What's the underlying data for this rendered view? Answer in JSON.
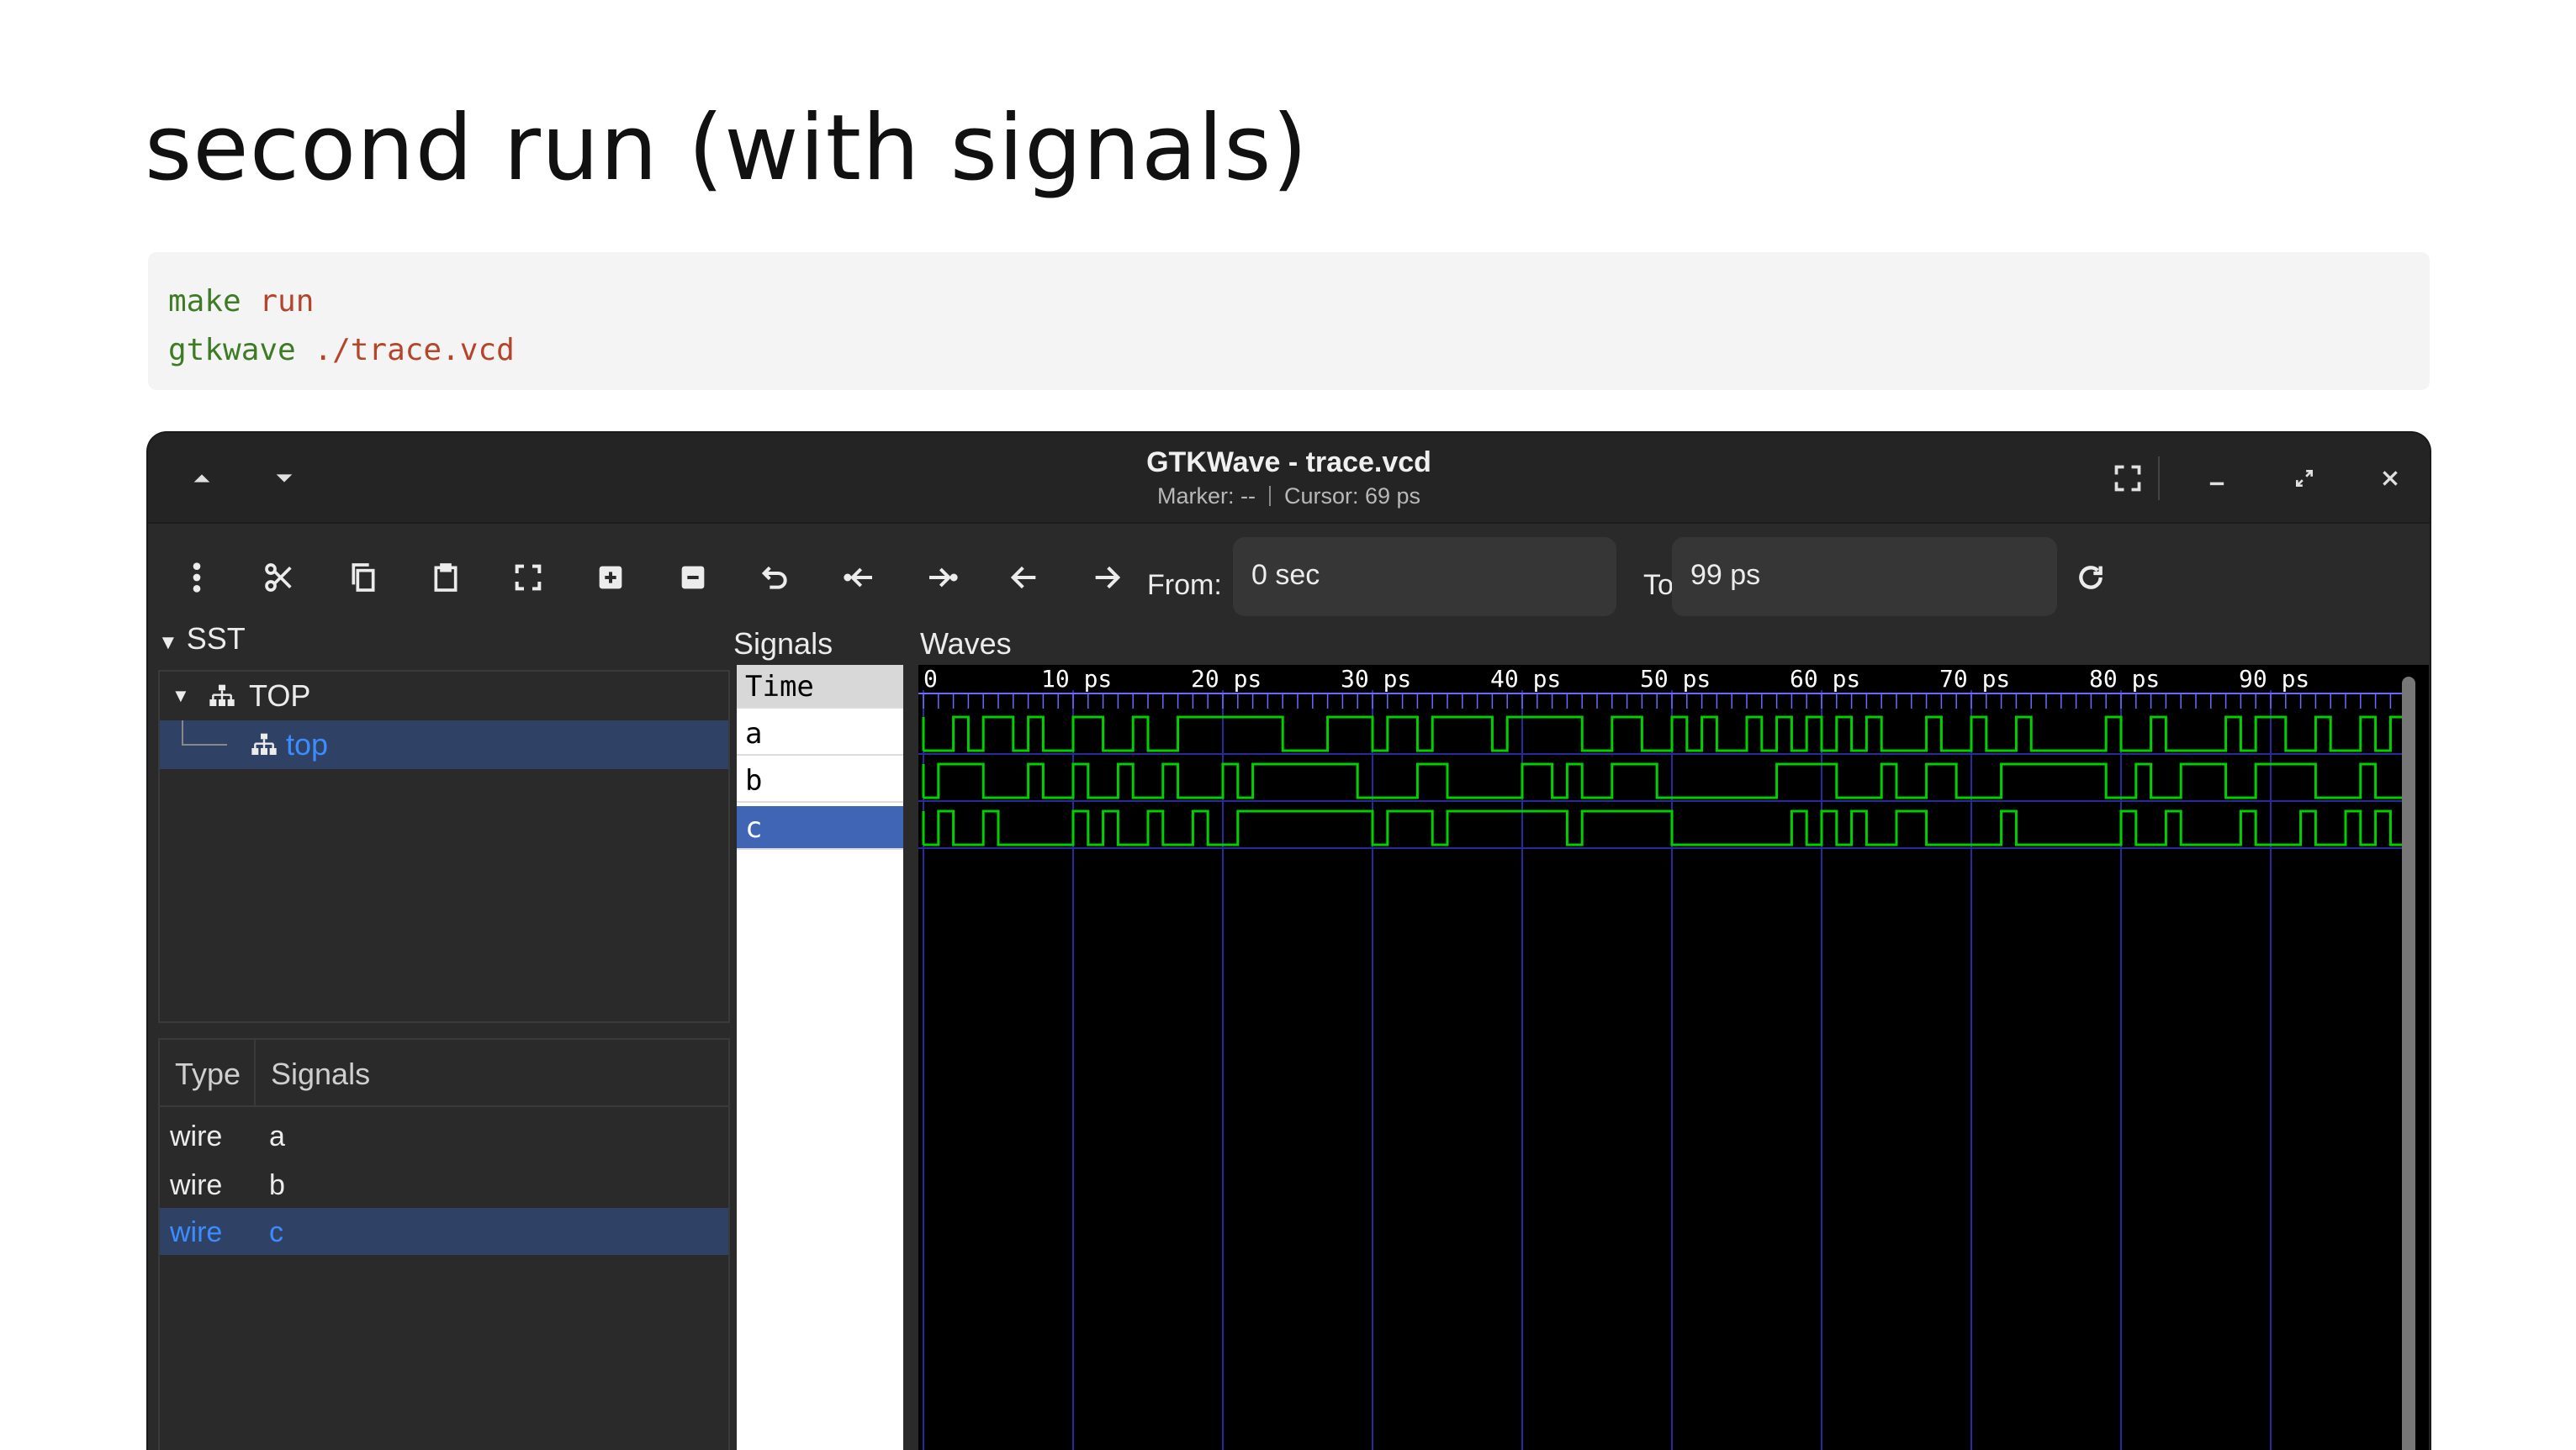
{
  "slide": {
    "title": "second run (with signals)",
    "code": [
      {
        "cmd": "make",
        "arg": " run"
      },
      {
        "cmd": "gtkwave",
        "arg": " ./trace.vcd"
      }
    ]
  },
  "window": {
    "title": "GTKWave - trace.vcd",
    "marker": "Marker: --",
    "cursor": "Cursor: 69 ps",
    "titlebar_icons": [
      "scroll-up-icon",
      "scroll-down-icon",
      "fullscreen-icon",
      "minimize-icon",
      "restore-icon",
      "close-icon"
    ]
  },
  "toolbar": {
    "icons": [
      "menu-icon",
      "cut-icon",
      "copy-icon",
      "paste-icon",
      "zoom-fit-icon",
      "zoom-in-icon",
      "zoom-out-icon",
      "undo-icon",
      "zoom-start-icon",
      "zoom-end-icon",
      "prev-edge-icon",
      "next-edge-icon"
    ],
    "from_label": "From:",
    "from_value": "0 sec",
    "to_label": "To:",
    "to_value": "99 ps",
    "reload_icon": "reload-icon"
  },
  "sst": {
    "header": "SST",
    "tree": [
      {
        "label": "TOP",
        "level": 0,
        "selected": false
      },
      {
        "label": "top",
        "level": 1,
        "selected": true
      }
    ],
    "table": {
      "columns": [
        "Type",
        "Signals"
      ],
      "rows": [
        {
          "type": "wire",
          "signal": "a",
          "selected": false
        },
        {
          "type": "wire",
          "signal": "b",
          "selected": false
        },
        {
          "type": "wire",
          "signal": "c",
          "selected": true
        }
      ]
    }
  },
  "signals": {
    "header": "Signals",
    "rows": [
      {
        "label": "Time",
        "selected": false
      },
      {
        "label": "a",
        "selected": false
      },
      {
        "label": "b",
        "selected": false
      },
      {
        "label": "c",
        "selected": true
      }
    ]
  },
  "waves": {
    "header": "Waves",
    "time_end": 99,
    "tick_labels": [
      "0",
      "10 ps",
      "20 ps",
      "30 ps",
      "40 ps",
      "50 ps",
      "60 ps",
      "70 ps",
      "80 ps",
      "90 ps"
    ],
    "tick_values": [
      0,
      10,
      20,
      30,
      40,
      50,
      60,
      70,
      80,
      90
    ],
    "colors": {
      "wave": "#00d000",
      "grid": "#2a2aa0",
      "tick": "#6a6aff",
      "text": "#ffffff"
    },
    "signals": [
      {
        "name": "a",
        "init": 0,
        "toggles": [
          2,
          3,
          4,
          6,
          7,
          8,
          10,
          12,
          14,
          15,
          17,
          24,
          27,
          30,
          31,
          33,
          34,
          38,
          39,
          44,
          46,
          48,
          50,
          51,
          52,
          53,
          55,
          56,
          57,
          58,
          59,
          60,
          61,
          62,
          63,
          64,
          67,
          68,
          70,
          71,
          73,
          74,
          79,
          80,
          82,
          83,
          87,
          88,
          89,
          91,
          93,
          94,
          96,
          97,
          98
        ]
      },
      {
        "name": "b",
        "init": 0,
        "toggles": [
          1,
          4,
          7,
          8,
          10,
          11,
          13,
          14,
          16,
          17,
          20,
          21,
          22,
          29,
          33,
          35,
          40,
          42,
          43,
          44,
          46,
          49,
          57,
          61,
          64,
          65,
          67,
          69,
          72,
          79,
          81,
          82,
          84,
          87,
          89,
          93,
          96,
          97,
          99
        ]
      },
      {
        "name": "c",
        "init": 0,
        "toggles": [
          1,
          2,
          4,
          5,
          10,
          11,
          12,
          13,
          15,
          16,
          18,
          19,
          21,
          30,
          31,
          34,
          35,
          43,
          44,
          50,
          58,
          59,
          60,
          61,
          62,
          63,
          65,
          67,
          72,
          73,
          80,
          81,
          83,
          84,
          88,
          89,
          92,
          93,
          95,
          96,
          97,
          98
        ]
      }
    ]
  }
}
